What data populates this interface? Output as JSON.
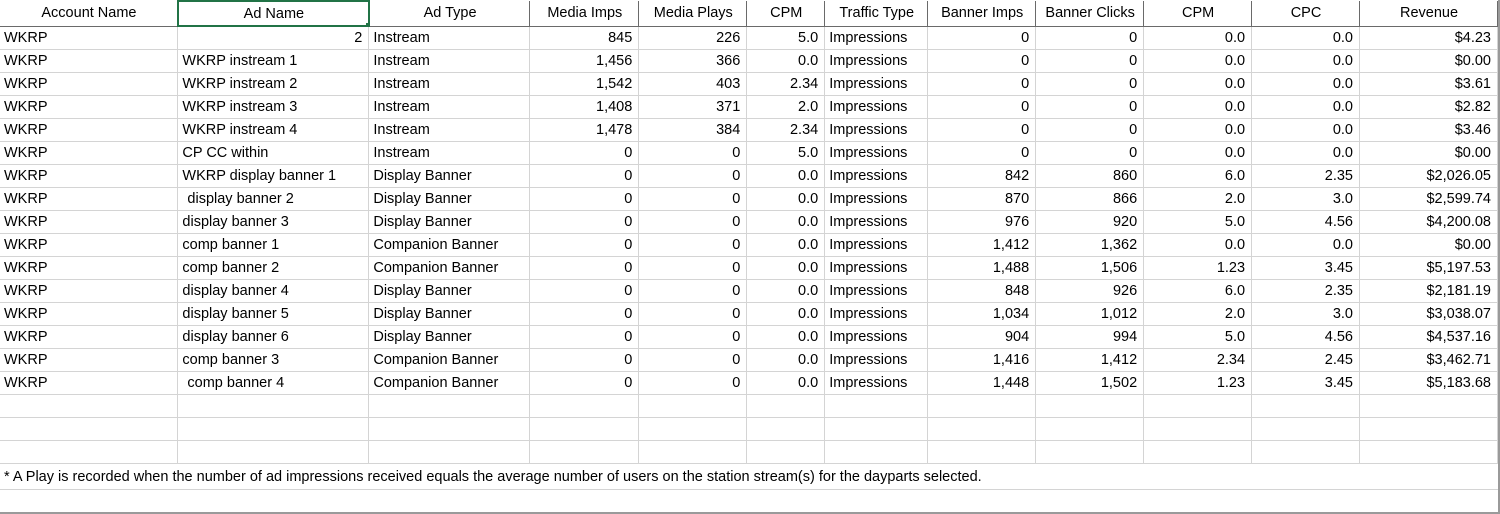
{
  "headers": [
    "Account Name",
    "Ad Name",
    "Ad Type",
    "Media Imps",
    "Media Plays",
    "CPM",
    "Traffic Type",
    "Banner Imps",
    "Banner Clicks",
    "CPM",
    "CPC",
    "Revenue"
  ],
  "rows": [
    [
      "WKRP",
      "2",
      "Instream",
      "845",
      "226",
      "5.0",
      "Impressions",
      "0",
      "0",
      "0.0",
      "0.0",
      "$4.23"
    ],
    [
      "WKRP",
      "WKRP instream 1",
      "Instream",
      "1,456",
      "366",
      "0.0",
      "Impressions",
      "0",
      "0",
      "0.0",
      "0.0",
      "$0.00"
    ],
    [
      "WKRP",
      "WKRP instream 2",
      "Instream",
      "1,542",
      "403",
      "2.34",
      "Impressions",
      "0",
      "0",
      "0.0",
      "0.0",
      "$3.61"
    ],
    [
      "WKRP",
      "WKRP instream 3",
      "Instream",
      "1,408",
      "371",
      "2.0",
      "Impressions",
      "0",
      "0",
      "0.0",
      "0.0",
      "$2.82"
    ],
    [
      "WKRP",
      "WKRP instream 4",
      "Instream",
      "1,478",
      "384",
      "2.34",
      "Impressions",
      "0",
      "0",
      "0.0",
      "0.0",
      "$3.46"
    ],
    [
      "WKRP",
      "CP CC within",
      "Instream",
      "0",
      "0",
      "5.0",
      "Impressions",
      "0",
      "0",
      "0.0",
      "0.0",
      "$0.00"
    ],
    [
      "WKRP",
      "WKRP display banner 1",
      "Display Banner",
      "0",
      "0",
      "0.0",
      "Impressions",
      "842",
      "860",
      "6.0",
      "2.35",
      "$2,026.05"
    ],
    [
      "WKRP",
      " display banner 2",
      "Display Banner",
      "0",
      "0",
      "0.0",
      "Impressions",
      "870",
      "866",
      "2.0",
      "3.0",
      "$2,599.74"
    ],
    [
      "WKRP",
      "display banner 3",
      "Display Banner",
      "0",
      "0",
      "0.0",
      "Impressions",
      "976",
      "920",
      "5.0",
      "4.56",
      "$4,200.08"
    ],
    [
      "WKRP",
      "comp banner 1",
      "Companion Banner",
      "0",
      "0",
      "0.0",
      "Impressions",
      "1,412",
      "1,362",
      "0.0",
      "0.0",
      "$0.00"
    ],
    [
      "WKRP",
      "comp banner 2",
      "Companion Banner",
      "0",
      "0",
      "0.0",
      "Impressions",
      "1,488",
      "1,506",
      "1.23",
      "3.45",
      "$5,197.53"
    ],
    [
      "WKRP",
      "display banner 4",
      "Display Banner",
      "0",
      "0",
      "0.0",
      "Impressions",
      "848",
      "926",
      "6.0",
      "2.35",
      "$2,181.19"
    ],
    [
      "WKRP",
      "display banner 5",
      "Display Banner",
      "0",
      "0",
      "0.0",
      "Impressions",
      "1,034",
      "1,012",
      "2.0",
      "3.0",
      "$3,038.07"
    ],
    [
      "WKRP",
      "display banner 6",
      "Display Banner",
      "0",
      "0",
      "0.0",
      "Impressions",
      "904",
      "994",
      "5.0",
      "4.56",
      "$4,537.16"
    ],
    [
      "WKRP",
      "comp banner 3",
      "Companion Banner",
      "0",
      "0",
      "0.0",
      "Impressions",
      "1,416",
      "1,412",
      "2.34",
      "2.45",
      "$3,462.71"
    ],
    [
      "WKRP",
      " comp banner 4",
      "Companion Banner",
      "0",
      "0",
      "0.0",
      "Impressions",
      "1,448",
      "1,502",
      "1.23",
      "3.45",
      "$5,183.68"
    ]
  ],
  "footnote": "* A Play is recorded when the number of ad impressions received equals the average number of users on the station stream(s) for the dayparts selected.",
  "colors": {
    "selection": "#217346",
    "gridline": "#d4d4d4"
  }
}
